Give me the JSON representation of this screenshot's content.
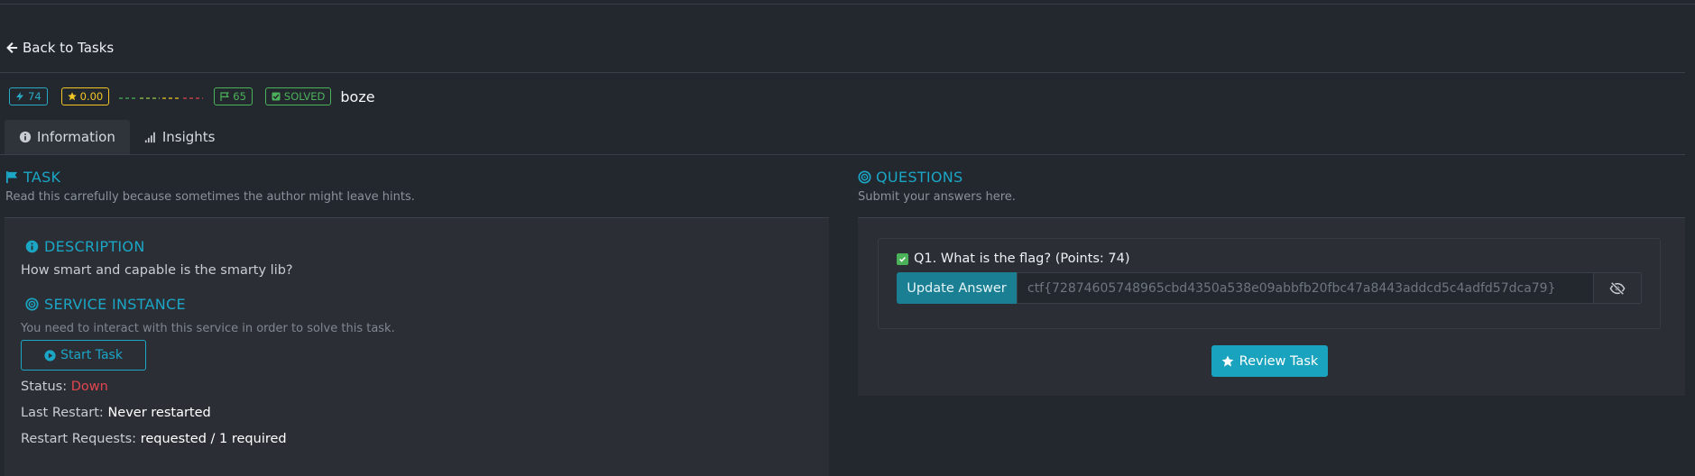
{
  "nav": {
    "back_label": "Back to Tasks"
  },
  "badges": {
    "points": "74",
    "rating": "0.00",
    "solves": "65",
    "solved": "SOLVED",
    "author": "boze"
  },
  "tabs": [
    {
      "label": "Information",
      "active": true
    },
    {
      "label": "Insights",
      "active": false
    }
  ],
  "task": {
    "title": "TASK",
    "subtitle": "Read this carrefully because sometimes the author might leave hints."
  },
  "description": {
    "title": "DESCRIPTION",
    "text": "How smart and capable is the smarty lib?"
  },
  "service": {
    "title": "SERVICE INSTANCE",
    "subtitle": "You need to interact with this service in order to solve this task.",
    "start_label": "Start Task",
    "status_label": "Status:",
    "status_value": "Down",
    "last_restart_label": "Last Restart:",
    "last_restart_value": "Never restarted",
    "restart_requests_label": "Restart Requests:",
    "restart_requests_value": "requested / 1 required"
  },
  "questions": {
    "title": "QUESTIONS",
    "subtitle": "Submit your answers here.",
    "items": [
      {
        "label": "Q1. What is the flag? (Points: 74)",
        "answer": "ctf{72874605748965cbd4350a538e09abbfb20fbc47a8443addcd5c4adfd57dca79}",
        "button_label": "Update Answer"
      }
    ],
    "review_label": "Review Task"
  },
  "colors": {
    "accent": "#1ba6c6",
    "success": "#4cb25a",
    "warning": "#f3c624",
    "danger": "#e0454f",
    "background": "#23272e",
    "panel": "#2b2f35"
  },
  "icons": {
    "back": "arrow-left-icon",
    "points": "bolt-icon",
    "rating": "star-icon",
    "solves": "flag-icon",
    "solved": "check-square-icon",
    "info": "info-circle-icon",
    "insights": "signal-bars-icon",
    "task": "flag-icon",
    "service": "target-icon",
    "questions": "target-icon",
    "start": "play-circle-icon",
    "reveal": "eye-slash-icon",
    "review": "star-icon"
  }
}
